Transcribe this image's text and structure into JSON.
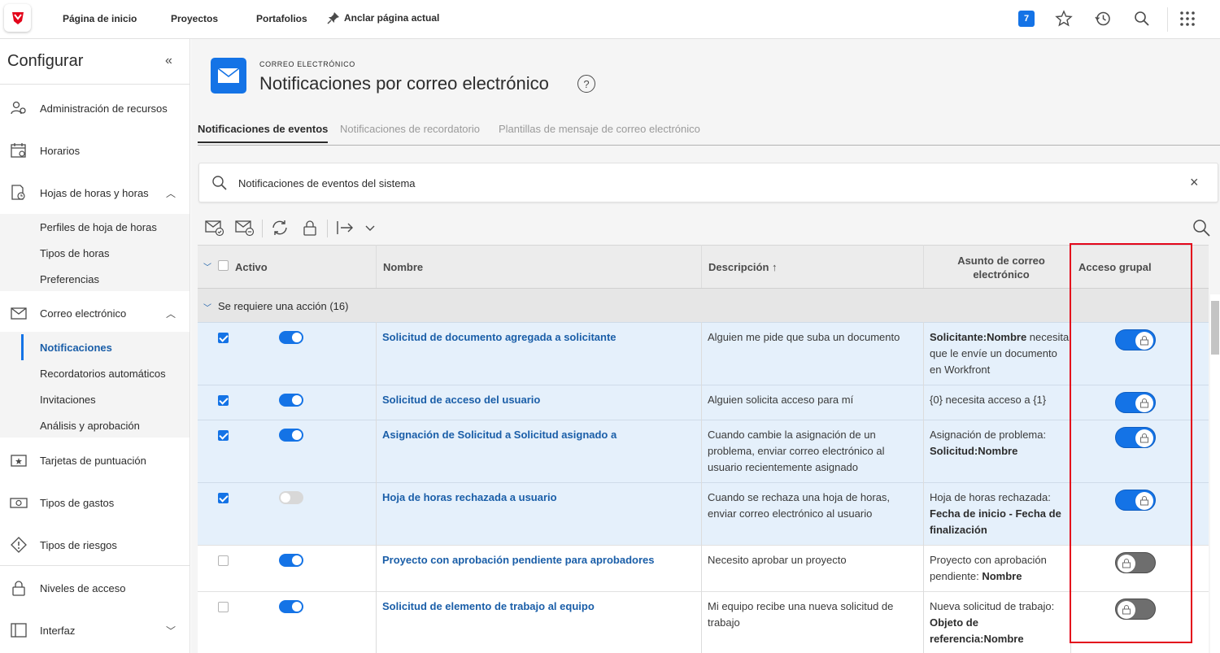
{
  "topbar": {
    "nav": [
      "Página de inicio",
      "Proyectos",
      "Portafolios"
    ],
    "pin_label": "Anclar página actual",
    "notifications_count": "7"
  },
  "sidebar": {
    "title": "Configurar",
    "collapse_glyph": "«",
    "items": [
      {
        "label": "Administración de recursos",
        "icon": "resource-management-icon"
      },
      {
        "label": "Horarios",
        "icon": "calendar-icon"
      },
      {
        "label": "Hojas de horas y horas",
        "icon": "timesheet-icon",
        "expanded": true
      },
      {
        "label": "Correo electrónico",
        "icon": "email-icon",
        "expanded": true
      },
      {
        "label": "Tarjetas de puntuación",
        "icon": "scorecard-icon"
      },
      {
        "label": "Tipos de gastos",
        "icon": "expense-icon"
      },
      {
        "label": "Tipos de riesgos",
        "icon": "risk-icon"
      },
      {
        "label": "Niveles de acceso",
        "icon": "lock-icon"
      },
      {
        "label": "Interfaz",
        "icon": "layout-icon",
        "expanded": false
      }
    ],
    "timesheet_sub": [
      "Perfiles de hoja de horas",
      "Tipos de horas",
      "Preferencias"
    ],
    "email_sub": [
      "Notificaciones",
      "Recordatorios automáticos",
      "Invitaciones",
      "Análisis y aprobación"
    ]
  },
  "header": {
    "eyebrow": "CORREO ELECTRÓNICO",
    "title": "Notificaciones por correo electrónico",
    "help": "?"
  },
  "tabs": [
    "Notificaciones de eventos",
    "Notificaciones de recordatorio",
    "Plantillas de mensaje de correo electrónico"
  ],
  "search": {
    "value": "Notificaciones de eventos del sistema",
    "clear": "×"
  },
  "table": {
    "columns": {
      "active": "Activo",
      "name": "Nombre",
      "description": "Descripción ↑",
      "subject_1": "Asunto de correo",
      "subject_2": "electrónico",
      "group_access": "Acceso grupal"
    },
    "group_label": "Se requiere una acción (16)",
    "rows": [
      {
        "selected": true,
        "active": true,
        "group_access": true,
        "name": "Solicitud de documento agregada a solicitante",
        "description": "Alguien me pide que suba un documento",
        "subject_bold": "Solicitante:Nombre",
        "subject_rest": " necesita que le envíe un documento en Workfront"
      },
      {
        "selected": true,
        "active": true,
        "group_access": true,
        "name": "Solicitud de acceso del usuario",
        "description": "Alguien solicita acceso para mí",
        "subject_plain": "{0} necesita acceso a {1}"
      },
      {
        "selected": true,
        "active": true,
        "group_access": true,
        "name": "Asignación de Solicitud a Solicitud asignado a",
        "description": "Cuando cambie la asignación de un problema, enviar correo electrónico al usuario recientemente asignado",
        "subject_pre": "Asignación de problema: ",
        "subject_bold": "Solicitud:Nombre"
      },
      {
        "selected": true,
        "active": false,
        "group_access": true,
        "name": "Hoja de horas rechazada a usuario",
        "description": "Cuando se rechaza una hoja de horas, enviar correo electrónico al usuario",
        "subject_pre": "Hoja de horas rechazada: ",
        "subject_bold": "Fecha de inicio - Fecha de finalización"
      },
      {
        "selected": false,
        "active": true,
        "group_access": false,
        "name": "Proyecto con aprobación pendiente para aprobadores",
        "description": "Necesito aprobar un proyecto",
        "subject_pre": "Proyecto con aprobación pendiente: ",
        "subject_bold": "Nombre"
      },
      {
        "selected": false,
        "active": true,
        "group_access": false,
        "name": "Solicitud de elemento de trabajo al equipo",
        "description": "Mi equipo recibe una nueva solicitud de trabajo",
        "subject_pre": "Nueva solicitud de trabajo: ",
        "subject_bold": "Objeto de referencia:Nombre"
      }
    ]
  },
  "colors": {
    "accent": "#1473e6",
    "link": "#1a5ea8",
    "highlight_box": "#e3061b",
    "selected_row": "#e5f0fb"
  }
}
